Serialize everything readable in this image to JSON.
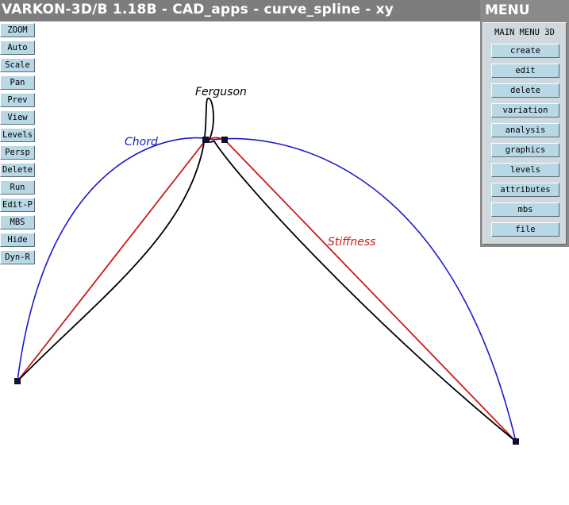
{
  "window": {
    "title": "VARKON-3D/B 1.18B - CAD_apps - curve_spline - xy"
  },
  "toolbar": {
    "buttons": [
      "ZOOM",
      "Auto",
      "Scale",
      "Pan",
      "Prev",
      "View",
      "Levels",
      "Persp",
      "Delete",
      "Run",
      "Edit-P",
      "MBS",
      "Hide",
      "Dyn-R"
    ]
  },
  "menu": {
    "title": "MENU",
    "header": "MAIN MENU 3D",
    "items": [
      "create",
      "edit",
      "delete",
      "variation",
      "analysis",
      "graphics",
      "levels",
      "attributes",
      "mbs",
      "file"
    ]
  },
  "drawing": {
    "labels": {
      "ferguson": "Ferguson",
      "chord": "Chord",
      "stiffness": "Stiffness"
    },
    "colors": {
      "ferguson": "#000000",
      "chord": "#1a1acc",
      "stiffness": "#cc1a1a",
      "point": "#101030"
    }
  }
}
